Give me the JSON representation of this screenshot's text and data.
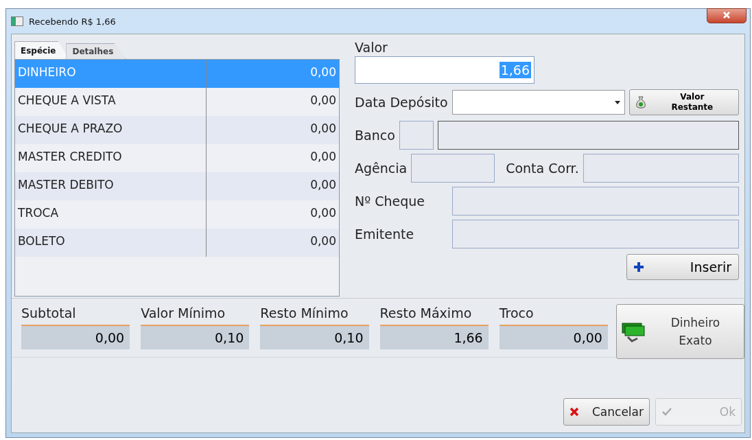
{
  "window": {
    "title": "Recebendo R$ 1,66"
  },
  "tabs": [
    {
      "label": "Espécie",
      "selected": true
    },
    {
      "label": "Detalhes",
      "selected": false
    }
  ],
  "payment_types": [
    {
      "name": "DINHEIRO",
      "amount": "0,00",
      "selected": true
    },
    {
      "name": "CHEQUE A VISTA",
      "amount": "0,00",
      "selected": false
    },
    {
      "name": "CHEQUE A PRAZO",
      "amount": "0,00",
      "selected": false
    },
    {
      "name": "MASTER CREDITO",
      "amount": "0,00",
      "selected": false
    },
    {
      "name": "MASTER DEBITO",
      "amount": "0,00",
      "selected": false
    },
    {
      "name": "TROCA",
      "amount": "0,00",
      "selected": false
    },
    {
      "name": "BOLETO",
      "amount": "0,00",
      "selected": false
    }
  ],
  "form": {
    "valor_label": "Valor",
    "valor": "1,66",
    "data_deposito_label": "Data Depósito",
    "valor_restante_button": [
      "Valor",
      "Restante"
    ],
    "banco_label": "Banco",
    "agencia_label": "Agência",
    "conta_label": "Conta Corr.",
    "cheque_label": "Nº Cheque",
    "emitente_label": "Emitente",
    "insert_button": "Inserir"
  },
  "summary": [
    {
      "label": "Subtotal",
      "value": "0,00"
    },
    {
      "label": "Valor Mínimo",
      "value": "0,10"
    },
    {
      "label": "Resto Mínimo",
      "value": "0,10"
    },
    {
      "label": "Resto Máximo",
      "value": "1,66"
    },
    {
      "label": "Troco",
      "value": "0,00"
    }
  ],
  "exact_cash_button": [
    "Dinheiro",
    "Exato"
  ],
  "buttons": [
    {
      "label": "Cancelar",
      "disabled": false
    },
    {
      "label": "Ok",
      "disabled": true
    }
  ]
}
